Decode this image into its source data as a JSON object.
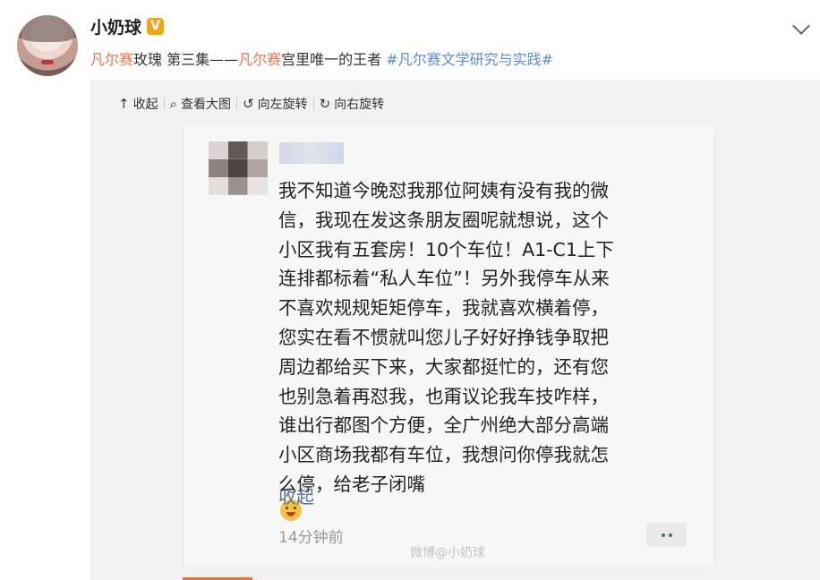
{
  "user": {
    "name": "小奶球",
    "badge": "V"
  },
  "post_text": {
    "hl1": "凡尔赛",
    "p1": "玫瑰 第三集——",
    "hl2": "凡尔赛",
    "p2": "宫里唯一的王者 ",
    "tag": "#凡尔赛文学研究与实践#"
  },
  "toolbar": {
    "collapse": "收起",
    "view_large": "查看大图",
    "rotate_left": "向左旋转",
    "rotate_right": "向右旋转"
  },
  "screenshot": {
    "lines": [
      "我不知道今晚怼我那位阿姨有没有我的微",
      "信，我现在发这条朋友圈呢就想说，这个",
      "小区我有五套房！10个车位！A1-C1上下",
      "连排都标着“私人车位”！另外我停车从来",
      "不喜欢规规矩矩停车，我就喜欢横着停，",
      "您实在看不惯就叫您儿子好好挣钱争取把",
      "周边都给买下来，大家都挺忙的，还有您",
      "也别急着再怼我，也甭议论我车技咋样，",
      "谁出行都图个方便，全广州绝大部分高端",
      "小区商场我都有车位，我想问你停我就怎",
      "么停，给老子闭嘴"
    ],
    "collapse_link": "收起",
    "time": "14分钟前",
    "watermark": "微博@小奶球"
  }
}
